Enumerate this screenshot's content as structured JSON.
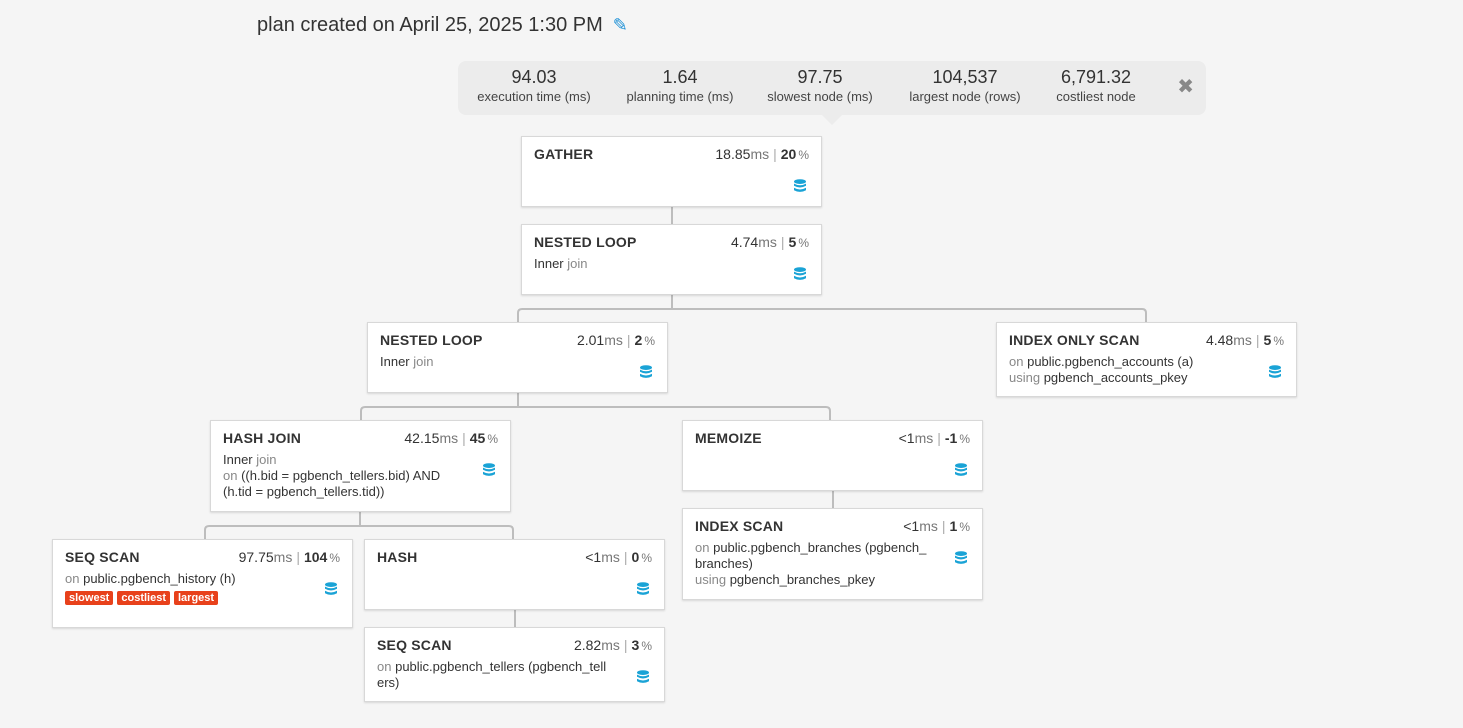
{
  "title": "plan created on April 25, 2025 1:30 PM",
  "icons": {
    "edit": "pencil-icon",
    "close": "close-icon",
    "node": "database-icon"
  },
  "colors": {
    "accent": "#1a8fd6",
    "badge": "#e8411b",
    "db_icon": "#1aa3d6"
  },
  "summary": {
    "execution_time": {
      "value": "94.03",
      "label": "execution time (ms)"
    },
    "planning_time": {
      "value": "1.64",
      "label": "planning time (ms)"
    },
    "slowest_node": {
      "value": "97.75",
      "label": "slowest node (ms)"
    },
    "largest_node": {
      "value": "104,537",
      "label": "largest node (rows)"
    },
    "costliest_node": {
      "value": "6,791.32",
      "label": "costliest node"
    }
  },
  "nodes": {
    "gather": {
      "name": "GATHER",
      "time": "18.85",
      "unit": "ms",
      "pct": "20",
      "pctsign": "%"
    },
    "nested_loop_1": {
      "name": "NESTED LOOP",
      "time": "4.74",
      "unit": "ms",
      "pct": "5",
      "pctsign": "%",
      "join_type": "Inner",
      "join_word": "join"
    },
    "nested_loop_2": {
      "name": "NESTED LOOP",
      "time": "2.01",
      "unit": "ms",
      "pct": "2",
      "pctsign": "%",
      "join_type": "Inner",
      "join_word": "join"
    },
    "index_only_scan": {
      "name": "INDEX ONLY SCAN",
      "time": "4.48",
      "unit": "ms",
      "pct": "5",
      "pctsign": "%",
      "on_word": "on",
      "relation": "public.pgbench_accounts (a)",
      "using_word": "using",
      "index": "pgbench_accounts_pkey"
    },
    "hash_join": {
      "name": "HASH JOIN",
      "time": "42.15",
      "unit": "ms",
      "pct": "45",
      "pctsign": "%",
      "join_type": "Inner",
      "join_word": "join",
      "on_word": "on",
      "condition": "((h.bid = pgbench_tellers.bid) AND (h.tid = pgbench_tellers.tid))"
    },
    "memoize": {
      "name": "MEMOIZE",
      "time": "<1",
      "unit": "ms",
      "pct": "-1",
      "pctsign": "%"
    },
    "seq_scan_history": {
      "name": "SEQ SCAN",
      "time": "97.75",
      "unit": "ms",
      "pct": "104",
      "pctsign": "%",
      "on_word": "on",
      "relation": "public.pgbench_history (h)",
      "badges": [
        "slowest",
        "costliest",
        "largest"
      ]
    },
    "hash": {
      "name": "HASH",
      "time": "<1",
      "unit": "ms",
      "pct": "0",
      "pctsign": "%"
    },
    "index_scan": {
      "name": "INDEX SCAN",
      "time": "<1",
      "unit": "ms",
      "pct": "1",
      "pctsign": "%",
      "on_word": "on",
      "relation": "public.pgbench_branches (pgbench_branches)",
      "using_word": "using",
      "index": "pgbench_branches_pkey"
    },
    "seq_scan_tellers": {
      "name": "SEQ SCAN",
      "time": "2.82",
      "unit": "ms",
      "pct": "3",
      "pctsign": "%",
      "on_word": "on",
      "relation": "public.pgbench_tellers (pgbench_tellers)"
    }
  }
}
